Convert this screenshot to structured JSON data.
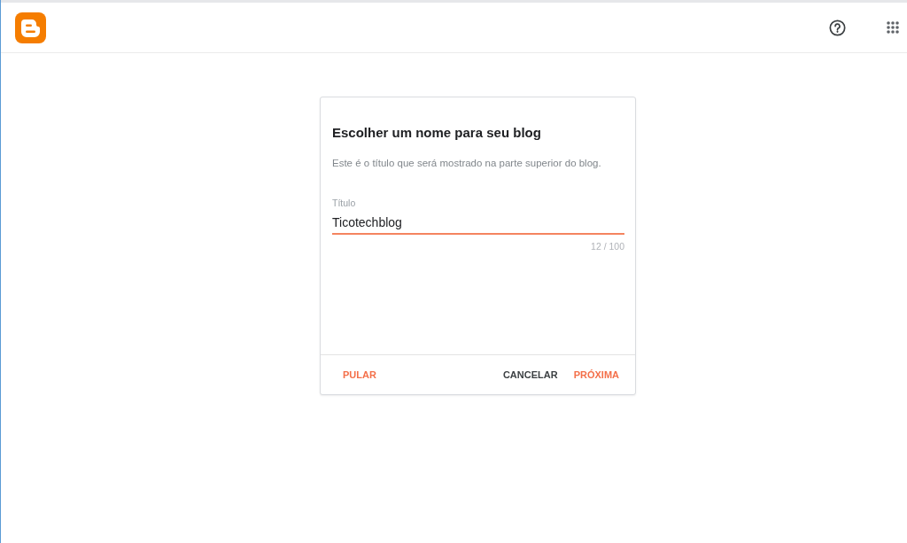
{
  "dialog": {
    "title": "Escolher um nome para seu blog",
    "subtitle": "Este é o título que será mostrado na parte superior do blog.",
    "field": {
      "label": "Título",
      "value": "Ticotechblog",
      "counter": "12 / 100",
      "focused": true
    },
    "actions": {
      "start": [
        {
          "label": "PULAR",
          "kind": "accent"
        }
      ],
      "end": [
        {
          "label": "CANCELAR",
          "kind": "plain"
        },
        {
          "label": "PRÓXIMA",
          "kind": "accent"
        }
      ]
    }
  }
}
